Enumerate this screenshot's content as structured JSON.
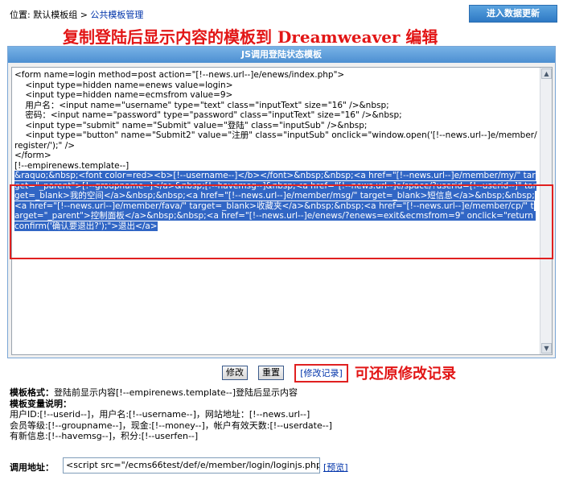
{
  "topbar": {
    "location_prefix": "位置: 默认模板组 > ",
    "location_link": "公共模板管理",
    "update_button": "进入数据更新"
  },
  "annotation": {
    "title": "复制登陆后显示内容的模板到 Dreamweaver 编辑",
    "restore_note": "可还原修改记录"
  },
  "panel": {
    "header": "JS调用登陆状态模板",
    "code_before": "<form name=login method=post action=\"[!--news.url--]e/enews/index.php\">\n    <input type=hidden name=enews value=login>\n    <input type=hidden name=ecmsfrom value=9>\n    用户名：<input name=\"username\" type=\"text\" class=\"inputText\" size=\"16\" />&nbsp;\n    密码：<input name=\"password\" type=\"password\" class=\"inputText\" size=\"16\" />&nbsp;\n    <input type=\"submit\" name=\"Submit\" value=\"登陆\" class=\"inputSub\" />&nbsp;\n    <input type=\"button\" name=\"Submit2\" value=\"注册\" class=\"inputSub\" onclick=\"window.open('[!--news.url--]e/member/register/');\" />\n</form>\n[!--empirenews.template--]\n",
    "code_selected": "&raquo;&nbsp;<font color=red><b>[!--username--]</b></font>&nbsp;&nbsp;<a href=\"[!--news.url--]e/member/my/\" target=\"_parent\">[!--groupname--]</a>&nbsp;[!--havemsg--]&nbsp;<a href=\"[!--news.url--]e/space/?userid=[!--userid--]\" target=_blank>我的空间</a>&nbsp;&nbsp;<a href=\"[!--news.url--]e/member/msg/\" target=_blank>短信息</a>&nbsp;&nbsp;<a href=\"[!--news.url--]e/member/fava/\" target=_blank>收藏夹</a>&nbsp;&nbsp;<a href=\"[!--news.url--]e/member/cp/\" target=\"_parent\">控制面板</a>&nbsp;&nbsp;<a href=\"[!--news.url--]e/enews/?enews=exit&ecmsfrom=9\" onclick=\"return confirm('确认要退出?');\">退出</a>"
  },
  "actions": {
    "modify": "修改",
    "reset": "重置",
    "record": "[修改记录]"
  },
  "info": {
    "format_label": "模板格式：",
    "format_text": "登陆前显示内容[!--empirenews.template--]登陆后显示内容",
    "vars_label": "模板变量说明：",
    "vars_line1": "用户ID:[!--userid--]，用户名:[!--username--]，网站地址：[!--news.url--]",
    "vars_line2": "会员等级:[!--groupname--]，现金:[!--money--]，帐户有效天数:[!--userdate--]",
    "vars_line3": "有新信息:[!--havemsg--]，积分:[!--userfen--]"
  },
  "url": {
    "label": "调用地址：",
    "value": "<script src=\"/ecms66test/def/e/member/login/loginjs.php",
    "preview": "[预览]"
  }
}
